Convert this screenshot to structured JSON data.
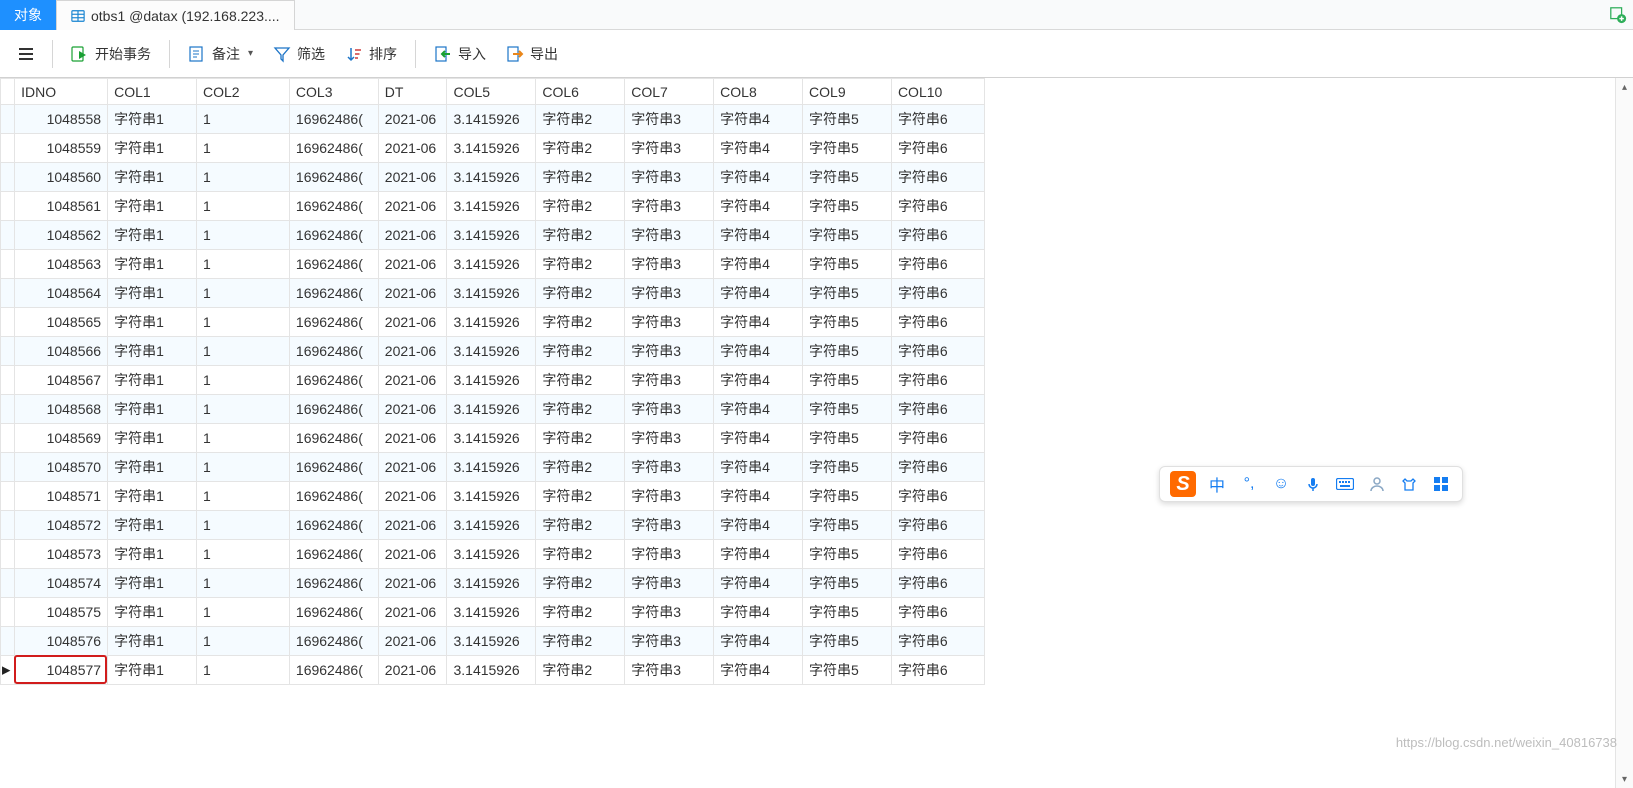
{
  "tabs": {
    "active_label": "对象",
    "inactive_label": "otbs1 @datax (192.168.223...."
  },
  "toolbar": {
    "begin_transaction": "开始事务",
    "comment": "备注",
    "filter": "筛选",
    "sort": "排序",
    "import": "导入",
    "export": "导出"
  },
  "columns": [
    "IDNO",
    "COL1",
    "COL2",
    "COL3",
    "DT",
    "COL5",
    "COL6",
    "COL7",
    "COL8",
    "COL9",
    "COL10"
  ],
  "repeat_values": {
    "COL1": "字符串1",
    "COL2": "1",
    "COL3": "16962486(",
    "DT": "2021-06",
    "COL5": "3.1415926",
    "COL6": "字符串2",
    "COL7": "字符串3",
    "COL8": "字符串4",
    "COL9": "字符串5",
    "COL10": "字符串6"
  },
  "idno_start": 1048558,
  "idno_end": 1048577,
  "highlighted_idno": 1048577,
  "ime": {
    "lang": "中"
  },
  "watermark": "https://blog.csdn.net/weixin_40816738"
}
